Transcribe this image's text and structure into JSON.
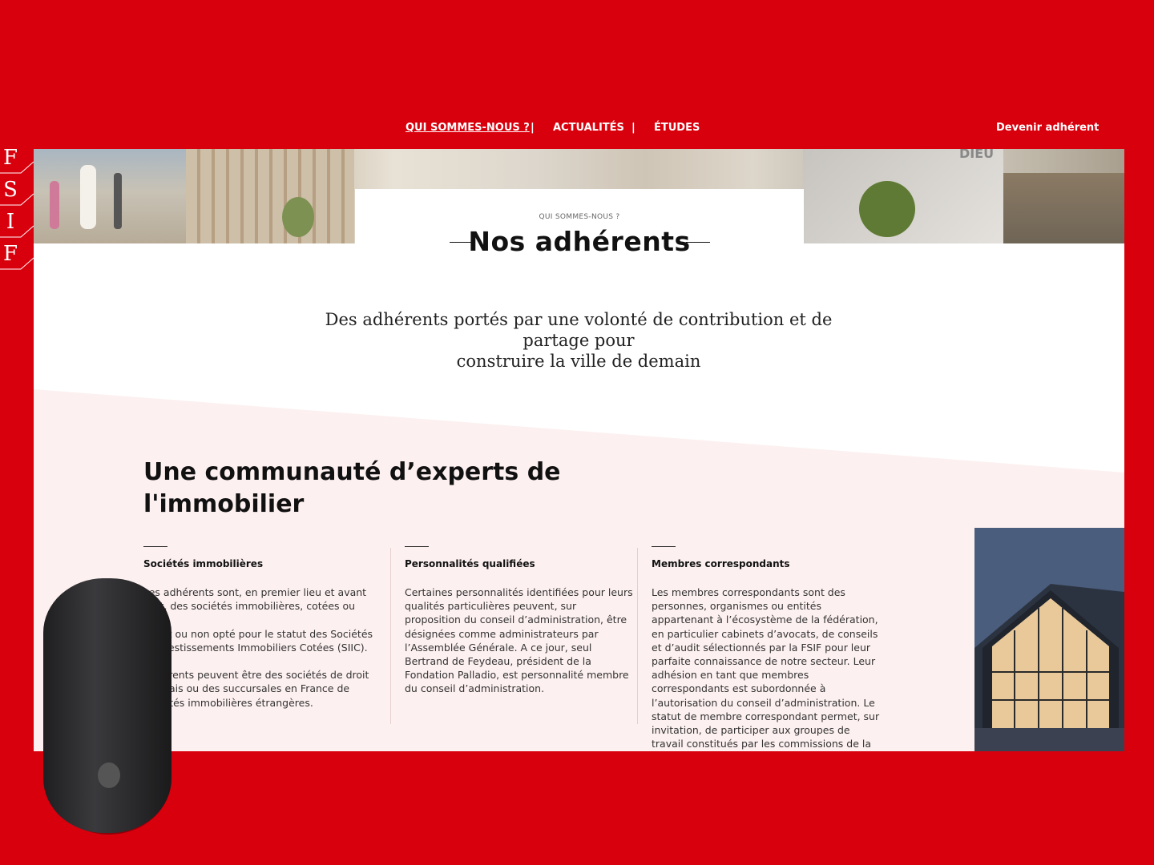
{
  "nav": {
    "items": [
      {
        "label": "QUI SOMMES-NOUS ?",
        "active": true
      },
      {
        "label": "ACTUALITÉS",
        "active": false
      },
      {
        "label": "ÉTUDES",
        "active": false
      }
    ],
    "separator": "|",
    "cta": "Devenir adhérent"
  },
  "logo": {
    "letters": [
      "F",
      "S",
      "I",
      "F"
    ]
  },
  "hero": {
    "eyebrow": "QUI SOMMES-NOUS ?",
    "title": "Nos adhérents",
    "building_sign": "DIEU"
  },
  "intro": {
    "line1": "Des adhérents portés par une volonté de contribution et de partage pour",
    "line2": "construire la ville de demain"
  },
  "section": {
    "title_line1": "Une communauté d’experts de",
    "title_line2": "l'immobilier"
  },
  "columns": [
    {
      "title": "Sociétés immobilières",
      "lines": [
        "Les adhérents sont, en premier lieu et avant",
        "tout, des sociétés immobilières, cotées ou non,",
        "ayant ou non opté pour le statut des Sociétés",
        "d’Investissements Immobiliers Cotées (SIIC). Ces",
        "adhérents peuvent être des sociétés de droit",
        "français ou des succursales en France de",
        "sociétés immobilières étrangères."
      ]
    },
    {
      "title": "Personnalités qualifiées",
      "lines": [
        "Certaines personnalités identifiées pour leurs",
        "qualités particulières peuvent, sur",
        "proposition du conseil d’administration, être",
        "désignées comme administrateurs par",
        "l’Assemblée Générale. A ce jour, seul",
        "Bertrand de Feydeau, président de la",
        "Fondation Palladio, est personnalité membre",
        "du conseil d’administration."
      ]
    },
    {
      "title": "Membres correspondants",
      "lines": [
        "Les membres correspondants sont des",
        "personnes, organismes ou entités",
        "appartenant à l’écosystème de la fédération,",
        "en particulier cabinets d’avocats, de conseils",
        "et d’audit sélectionnés par la FSIF pour leur",
        "parfaite connaissance de notre secteur. Leur",
        "adhésion en tant que membres",
        "correspondants est subordonnée à",
        "l’autorisation du conseil d’administration. Le",
        "statut de membre correspondant permet, sur",
        "invitation, de participer aux groupes de",
        "travail constitués par les commissions de la"
      ]
    }
  ],
  "colors": {
    "brand_red": "#d9000d",
    "page_bg": "#ffffff",
    "pink_band": "#fdf0f0",
    "text_dark": "#111111"
  }
}
